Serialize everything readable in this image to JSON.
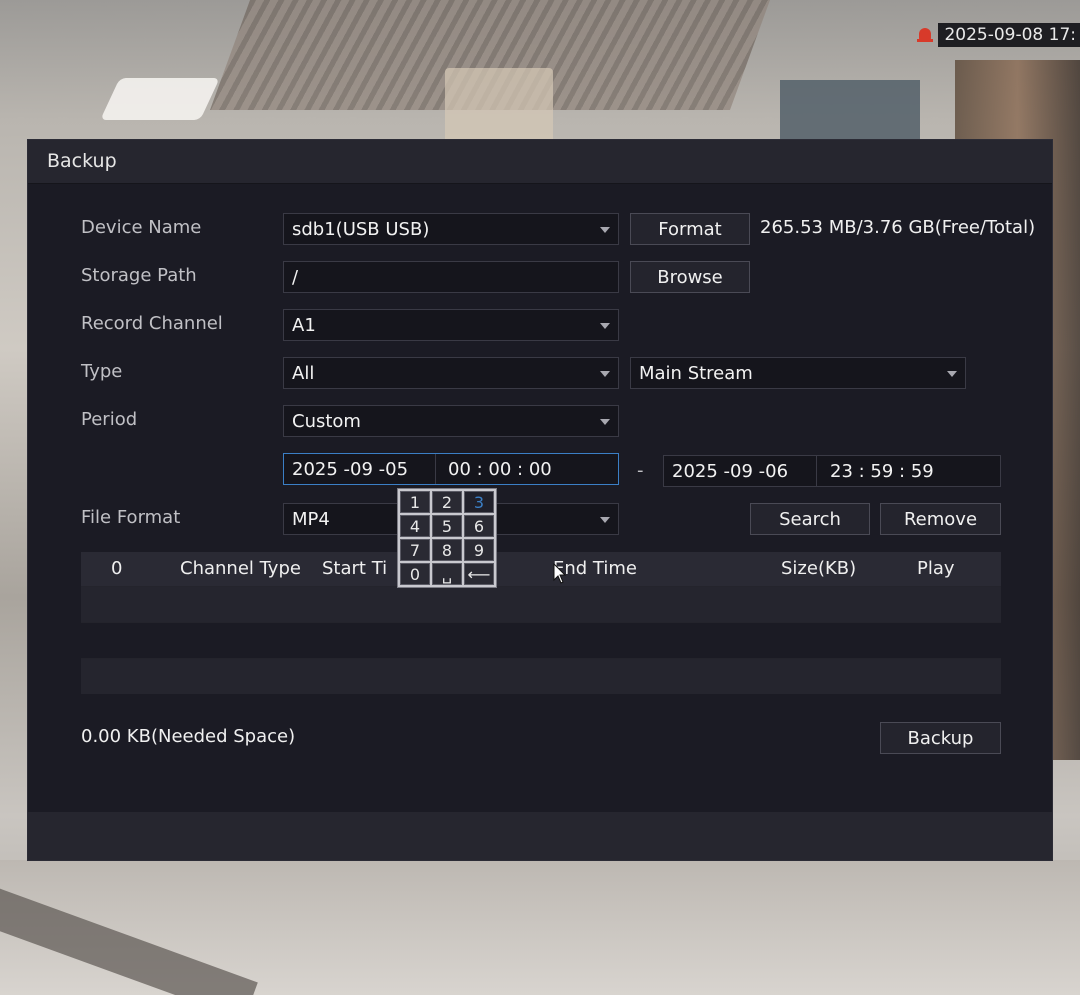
{
  "status": {
    "datetime": "2025-09-08 17:"
  },
  "dialog": {
    "title": "Backup",
    "device_name": {
      "label": "Device Name",
      "value": "sdb1(USB USB)",
      "format_button": "Format",
      "space_info": "265.53 MB/3.76 GB(Free/Total)"
    },
    "storage_path": {
      "label": "Storage Path",
      "value": "/",
      "browse_button": "Browse"
    },
    "record_channel": {
      "label": "Record Channel",
      "value": "A1"
    },
    "type": {
      "label": "Type",
      "value": "All",
      "stream_value": "Main Stream"
    },
    "period": {
      "label": "Period",
      "value": "Custom",
      "start_date": "2025  -09 -05",
      "start_time": "00 : 00 : 00",
      "separator": "-",
      "end_date": "2025  -09 -06",
      "end_time": "23 : 59 : 59"
    },
    "file_format": {
      "label": "File Format",
      "value": "MP4",
      "search_button": "Search",
      "remove_button": "Remove"
    },
    "table": {
      "headers": [
        "0",
        "Channel Type",
        "Start Ti",
        "End Time",
        "Size(KB)",
        "Play"
      ]
    },
    "needed_space": "0.00 KB(Needed Space)",
    "backup_button": "Backup"
  },
  "keypad": {
    "keys": [
      "1",
      "2",
      "3",
      "4",
      "5",
      "6",
      "7",
      "8",
      "9",
      "0",
      "␣",
      "⟵"
    ],
    "active_key": "3"
  },
  "colors": {
    "dialog_bg": "#1b1b24",
    "focus_border": "#3b7fc6",
    "alarm_icon": "#d83a2a"
  }
}
